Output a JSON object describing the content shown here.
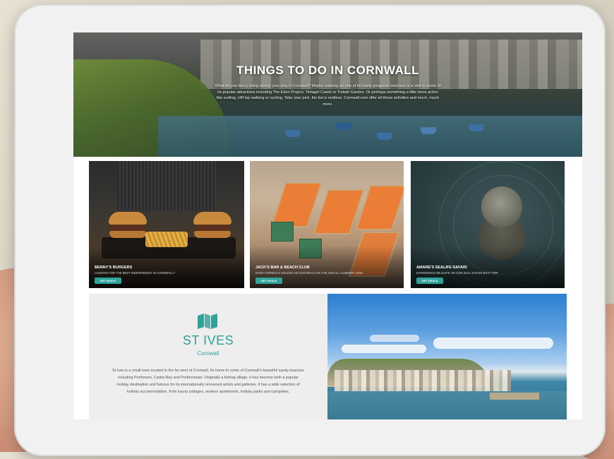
{
  "hero": {
    "title": "THINGS TO DO IN CORNWALL",
    "text": "What do you fancy doing during your stay in Cornwall? Maybe relaxing on one of its many gorgeous beaches or a visit to some of its popular attractions including The Eden Project, Tintagel Castle or Trebah Garden. Or perhaps something a little more active like surfing, cliff top walking or cycling. Take your pick, the list is endless. Cornwall.com offer all these activities and much, much more."
  },
  "cards": [
    {
      "title": "BENNY'S BURGERS",
      "subtitle": "LOOKING FOR THE BEST INDEPENDENT IN CORNWALL?",
      "button": "GET DEALS"
    },
    {
      "title": "JACK'S BAR & BEACH CLUB",
      "subtitle": "ENJOY DRINKS & SNACKS ON OUR BEACH IN THE SUN ALL SUMMER LONG",
      "button": "GET DEALS"
    },
    {
      "title": "AMARE'S SEALIFE SAFARI",
      "subtitle": "EXPERIENCE WILDLIFE ON OUR SEAL SAFARI BOAT TRIP",
      "button": "GET DEALS"
    }
  ],
  "destination": {
    "icon": "map-icon",
    "title": "ST IVES",
    "subtitle": "Cornwall",
    "text": "St Ives is a small town located in the far west of Cornwall. Its home to some of Cornwall's beautiful sandy beaches including Porthmeor, Carbis Bay and Porthminster. Originally a fishing village, it has become both a popular holiday destination and famous for its internationally renowned artists and galleries. It has a wide selection of holiday accommodation, from luxury cottages, modern apartments, holiday parks and campsites."
  },
  "colors": {
    "accent": "#2ea39a"
  }
}
